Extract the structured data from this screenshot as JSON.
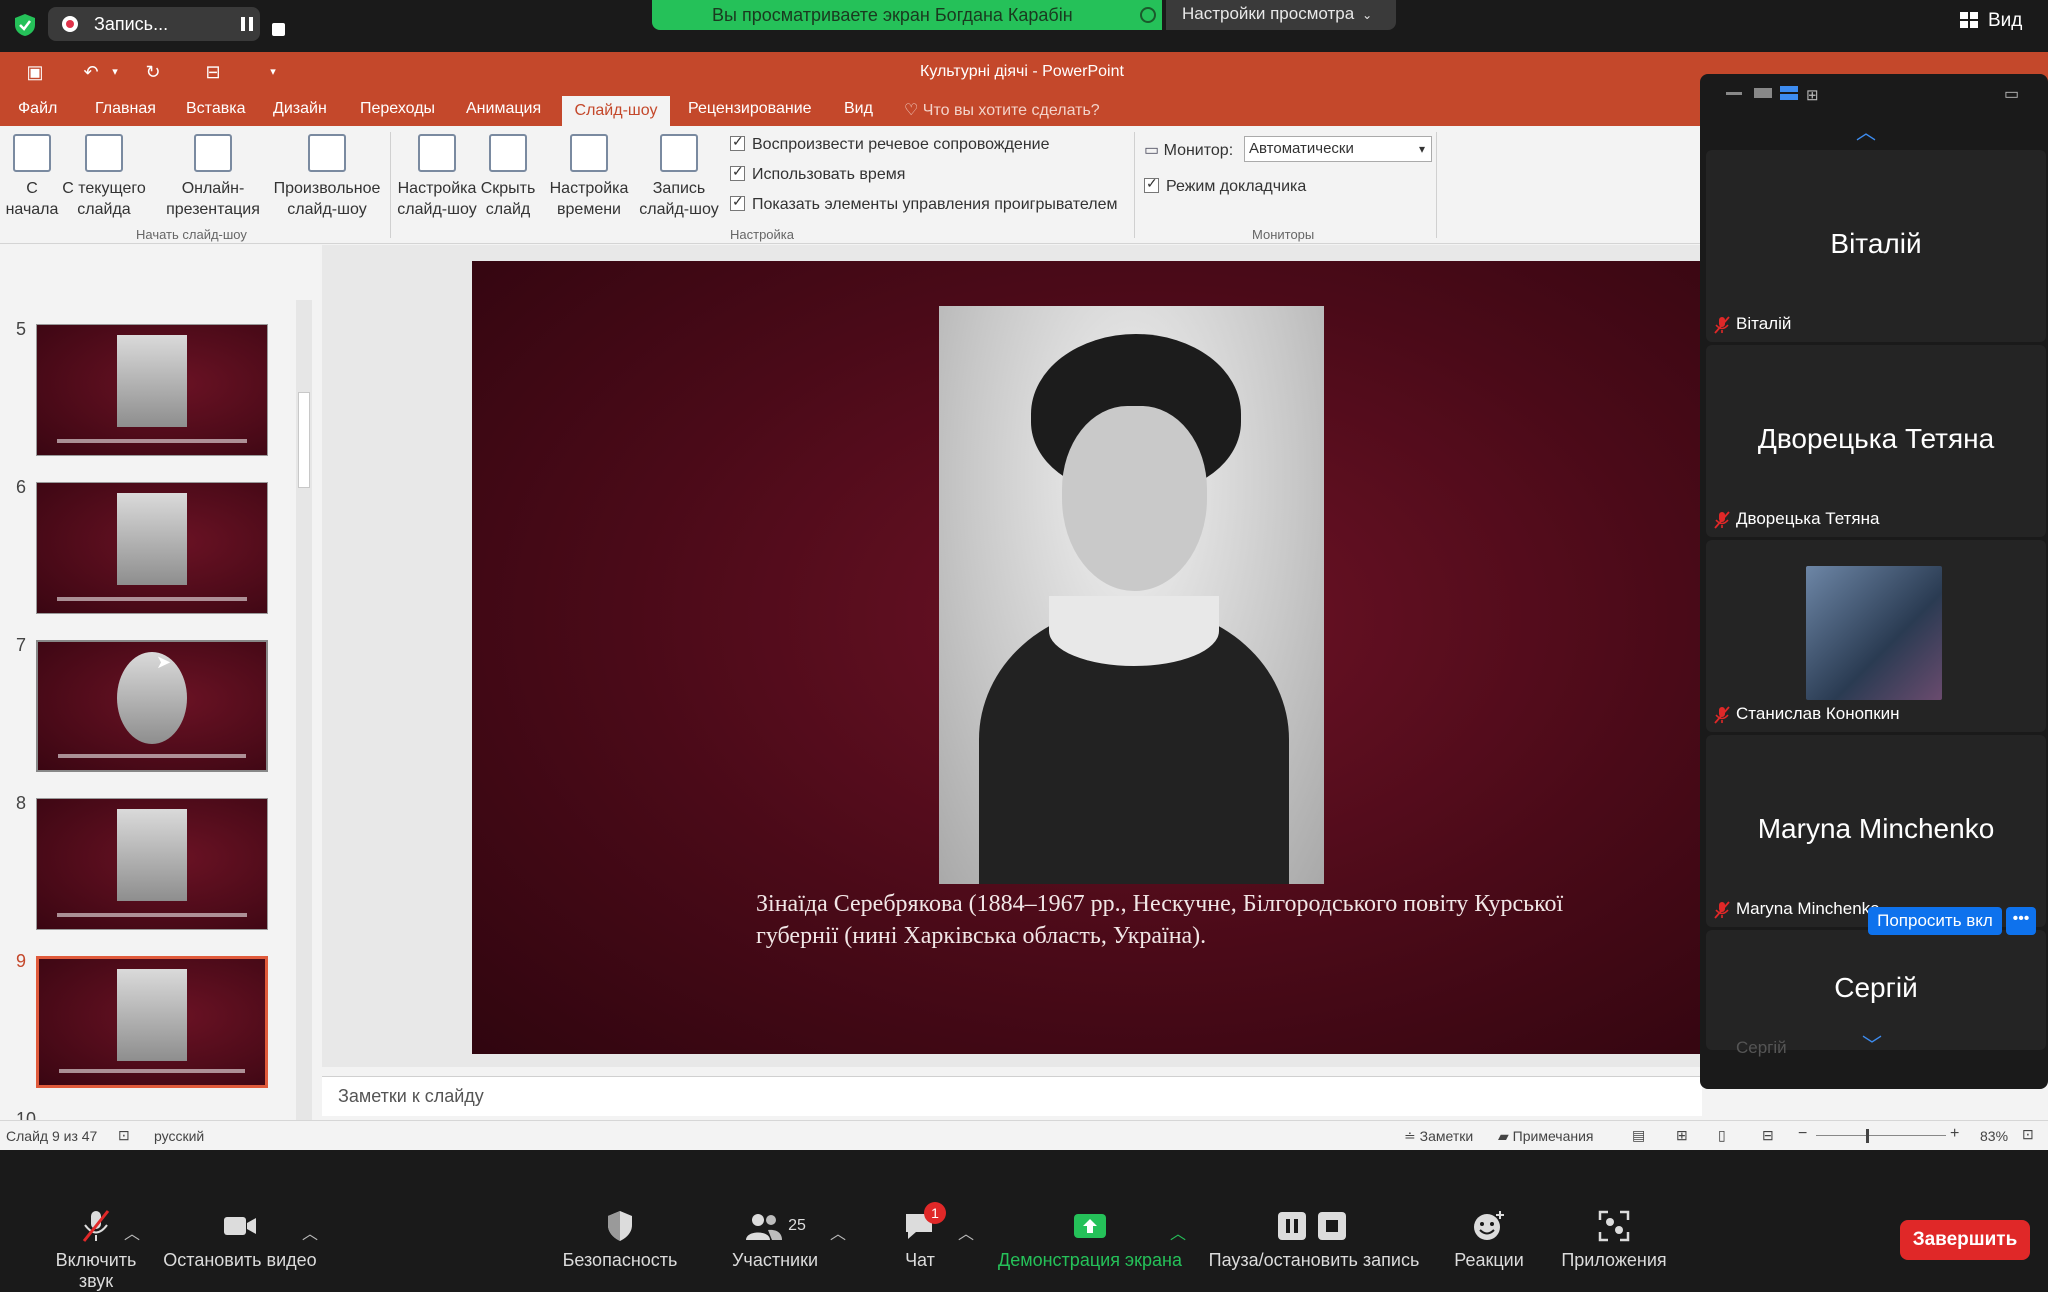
{
  "zoom_top": {
    "recording_label": "Запись...",
    "share_banner": "Вы просматриваете экран Богдана Карабін",
    "view_settings": "Настройки просмотра",
    "view_button": "Вид"
  },
  "ppt": {
    "window_title": "Культурні діячі - PowerPoint",
    "tabs": [
      "Файл",
      "Главная",
      "Вставка",
      "Дизайн",
      "Переходы",
      "Анимация",
      "Слайд-шоу",
      "Рецензирование",
      "Вид"
    ],
    "active_tab": "Слайд-шоу",
    "tell_me": "Что вы хотите сделать?",
    "ribbon": {
      "from_start": "С начала",
      "from_current": "С текущего слайда",
      "online": "Онлайн-презентация",
      "custom": "Произвольное слайд-шоу",
      "group_start": "Начать слайд-шоу",
      "setup": "Настройка слайд-шоу",
      "hide": "Скрыть слайд",
      "timings": "Настройка времени",
      "record": "Запись слайд-шоу",
      "cb_narration": "Воспроизвести речевое сопровождение",
      "cb_timings": "Использовать время",
      "cb_controls": "Показать элементы управления проигрывателем",
      "group_setup": "Настройка",
      "monitor_label": "Монитор:",
      "monitor_value": "Автоматически",
      "presenter_view": "Режим докладчика",
      "group_monitors": "Мониторы"
    },
    "slide_numbers": [
      "5",
      "6",
      "7",
      "8",
      "9",
      "10"
    ],
    "current_slide_number": "9",
    "slide_caption": "Зінаїда Серебрякова (1884–1967 рр., Нескучне, Білгородського повіту Курської губернії (нині Харківська область, Україна).",
    "notes_placeholder": "Заметки к слайду",
    "status": {
      "slide_info": "Слайд 9 из 47",
      "language": "русский",
      "notes": "Заметки",
      "comments": "Примечания",
      "zoom": "83%"
    }
  },
  "participants": [
    {
      "display": "Віталій",
      "label": "Віталій"
    },
    {
      "display": "Дворецька Тетяна",
      "label": "Дворецька Тетяна"
    },
    {
      "display": "",
      "label": "Станислав Конопкин"
    },
    {
      "display": "Maryna Minchenko",
      "label": "Maryna Minchenko"
    },
    {
      "display": "Сергій",
      "label": "Сергій"
    }
  ],
  "ask_button": "Попросить вкл",
  "more_button": "•••",
  "zoom_bottom": {
    "mute": "Включить звук",
    "video": "Остановить видео",
    "security": "Безопасность",
    "participants": "Участники",
    "participants_count": "25",
    "chat": "Чат",
    "chat_badge": "1",
    "share": "Демонстрация экрана",
    "pause_record": "Пауза/остановить запись",
    "reactions": "Реакции",
    "apps": "Приложения",
    "end": "Завершить"
  },
  "colors": {
    "ppt_accent": "#c4482b",
    "zoom_green": "#25c159",
    "zoom_blue": "#0e72ed",
    "end_red": "#e02828"
  }
}
